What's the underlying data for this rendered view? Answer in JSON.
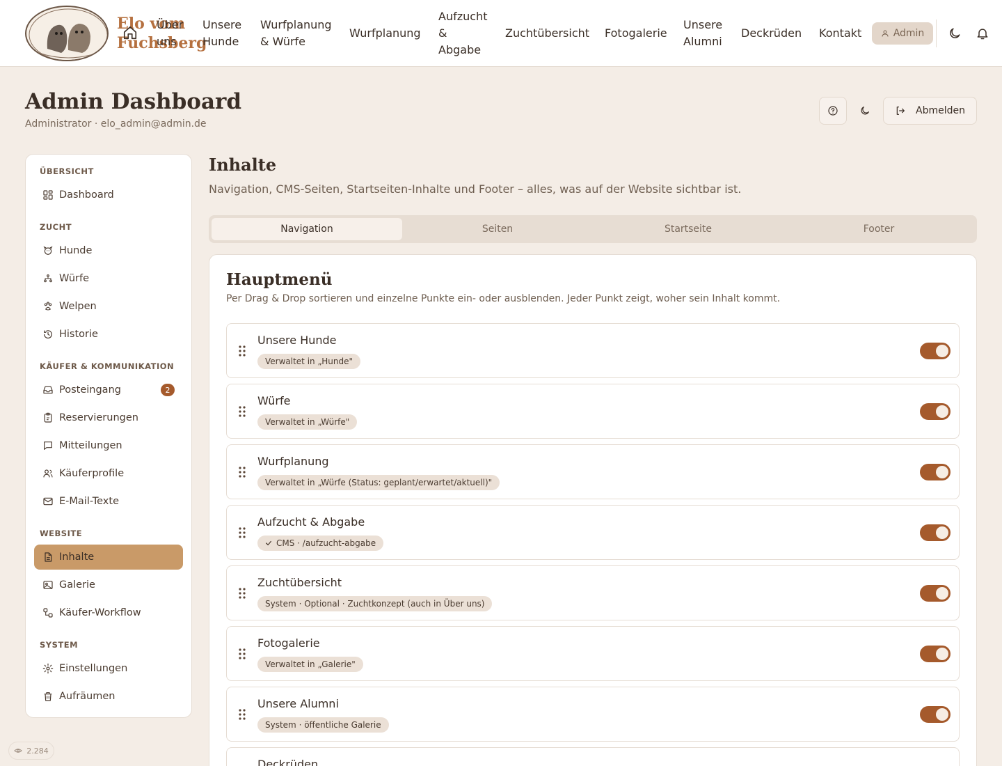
{
  "header": {
    "brand": "Elo vom Fuchsberg",
    "logo_text": "ELO",
    "nav": [
      {
        "label": "Über uns"
      },
      {
        "label": "Unsere Hunde"
      },
      {
        "label": "Wurfplanung & Würfe"
      },
      {
        "label": "Wurfplanung"
      },
      {
        "label": "Aufzucht & Abgabe"
      },
      {
        "label": "Zuchtübersicht"
      },
      {
        "label": "Fotogalerie"
      },
      {
        "label": "Unsere Alumni"
      },
      {
        "label": "Deckrüden"
      },
      {
        "label": "Kontakt"
      }
    ],
    "admin_label": "Admin"
  },
  "page": {
    "title": "Admin Dashboard",
    "subtitle": "Administrator · elo_admin@admin.de",
    "logout_label": "Abmelden"
  },
  "sidebar": {
    "sections": [
      {
        "label": "ÜBERSICHT"
      },
      {
        "label": "ZUCHT"
      },
      {
        "label": "KÄUFER & KOMMUNIKATION"
      },
      {
        "label": "WEBSITE"
      },
      {
        "label": "SYSTEM"
      }
    ],
    "items": [
      {
        "label": "Dashboard"
      },
      {
        "label": "Hunde"
      },
      {
        "label": "Würfe"
      },
      {
        "label": "Welpen"
      },
      {
        "label": "Historie"
      },
      {
        "label": "Posteingang",
        "badge": "2"
      },
      {
        "label": "Reservierungen"
      },
      {
        "label": "Mitteilungen"
      },
      {
        "label": "Käuferprofile"
      },
      {
        "label": "E-Mail-Texte"
      },
      {
        "label": "Inhalte"
      },
      {
        "label": "Galerie"
      },
      {
        "label": "Käufer-Workflow"
      },
      {
        "label": "Einstellungen"
      },
      {
        "label": "Aufräumen"
      }
    ]
  },
  "content": {
    "title": "Inhalte",
    "subtitle": "Navigation, CMS-Seiten, Startseiten-Inhalte und Footer – alles, was auf der Website sichtbar ist.",
    "tabs": [
      {
        "label": "Navigation"
      },
      {
        "label": "Seiten"
      },
      {
        "label": "Startseite"
      },
      {
        "label": "Footer"
      }
    ],
    "card": {
      "title": "Hauptmenü",
      "subtitle": "Per Drag & Drop sortieren und einzelne Punkte ein- oder ausblenden. Jeder Punkt zeigt, woher sein Inhalt kommt.",
      "rows": [
        {
          "title": "Unsere Hunde",
          "tag": "Verwaltet in „Hunde\"",
          "enabled": true
        },
        {
          "title": "Würfe",
          "tag": "Verwaltet in „Würfe\"",
          "enabled": true
        },
        {
          "title": "Wurfplanung",
          "tag": "Verwaltet in „Würfe (Status: geplant/erwartet/aktuell)\"",
          "enabled": true
        },
        {
          "title": "Aufzucht & Abgabe",
          "tag": "CMS · /aufzucht-abgabe",
          "enabled": true
        },
        {
          "title": "Zuchtübersicht",
          "tag": "System · Optional · Zuchtkonzept (auch in Über uns)",
          "enabled": true
        },
        {
          "title": "Fotogalerie",
          "tag": "Verwaltet in „Galerie\"",
          "enabled": true
        },
        {
          "title": "Unsere Alumni",
          "tag": "System · öffentliche Galerie",
          "enabled": true
        },
        {
          "title": "Deckrüden",
          "tag": "",
          "enabled": true
        }
      ]
    }
  },
  "footer": {
    "views": "2.284"
  },
  "colors": {
    "accent": "#a55a2c",
    "active_nav": "#c99a68",
    "background": "#f4ede6",
    "brand": "#b5703f"
  }
}
